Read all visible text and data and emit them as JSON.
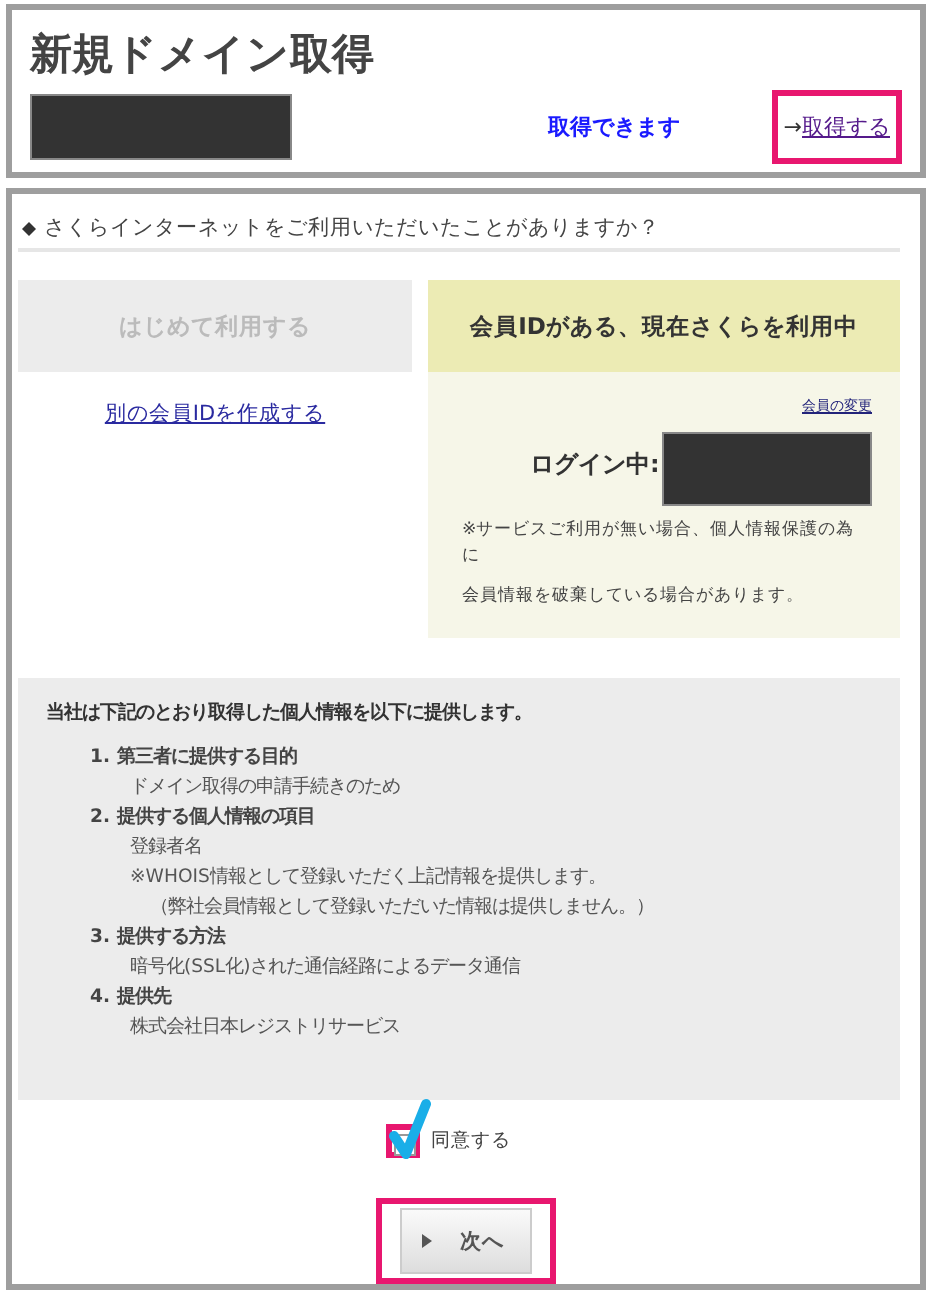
{
  "title": "新規ドメイン取得",
  "domain_result": {
    "status": "取得できます",
    "action_arrow": "→",
    "action": "取得する",
    "highlighted": true
  },
  "question": "さくらインターネットをご利用いただいたことがありますか？",
  "options": [
    {
      "label": "はじめて利用する",
      "selected": false,
      "link": "別の会員IDを作成する"
    },
    {
      "label": "会員IDがある、現在さくらを利用中",
      "selected": true,
      "change_link": "会員の変更",
      "login_label": "ログイン中:",
      "note": [
        "※サービスご利用が無い場合、個人情報保護の為に",
        "会員情報を破棄している場合があります。"
      ]
    }
  ],
  "disclosure": {
    "intro": "当社は下記のとおり取得した個人情報を以下に提供します。",
    "items": [
      {
        "number": "1.",
        "heading": "第三者に提供する目的",
        "lines": [
          "ドメイン取得の申請手続きのため"
        ]
      },
      {
        "number": "2.",
        "heading": "提供する個人情報の項目",
        "lines": [
          "登録者名",
          "※WHOIS情報として登録いただく上記情報を提供します。",
          "（弊社会員情報として登録いただいた情報は提供しません。）"
        ]
      },
      {
        "number": "3.",
        "heading": "提供する方法",
        "lines": [
          "暗号化(SSL化)された通信経路によるデータ通信"
        ]
      },
      {
        "number": "4.",
        "heading": "提供先",
        "lines": [
          "株式会社日本レジストリサービス"
        ]
      }
    ]
  },
  "agree": {
    "label": "同意する",
    "checked": true,
    "highlighted": true
  },
  "next_button": {
    "label": "次へ",
    "highlighted": true
  }
}
